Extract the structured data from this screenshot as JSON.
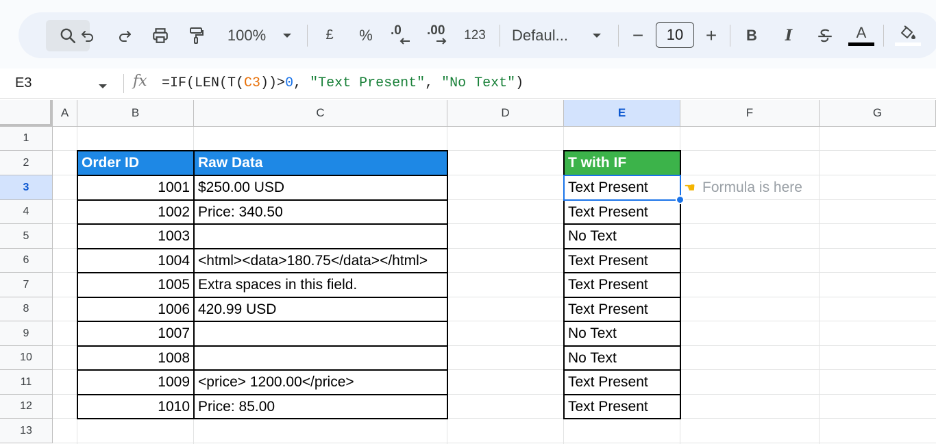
{
  "toolbar": {
    "zoom": "100%",
    "currency": "£",
    "percent": "%",
    "decrease_decimal": ".0",
    "increase_decimal": ".00",
    "number_format": "123",
    "font": "Defaul...",
    "font_size": "10",
    "minus": "−",
    "plus": "+",
    "bold": "B",
    "italic": "I",
    "text_color_letter": "A"
  },
  "formula_bar": {
    "name_box": "E3",
    "fx": "fx",
    "formula_parts": {
      "p1": "=IF(LEN(T(",
      "ref": "C3",
      "p2": "))>",
      "num": "0",
      "p3": ", ",
      "str1": "\"Text Present\"",
      "p4": ", ",
      "str2": "\"No Text\"",
      "p5": ")"
    }
  },
  "columns": [
    "A",
    "B",
    "C",
    "D",
    "E",
    "F",
    "G"
  ],
  "active_column": "E",
  "rows": [
    "1",
    "2",
    "3",
    "4",
    "5",
    "6",
    "7",
    "8",
    "9",
    "10",
    "11",
    "12",
    "13"
  ],
  "active_row": "3",
  "table1": {
    "headers": [
      "Order ID",
      "Raw Data"
    ],
    "rows": [
      [
        "1001",
        "$250.00 USD"
      ],
      [
        "1002",
        "Price: 340.50"
      ],
      [
        "1003",
        ""
      ],
      [
        "1004",
        "<html><data>180.75</data></html>"
      ],
      [
        "1005",
        "Extra spaces in this field."
      ],
      [
        "1006",
        "420.99 USD"
      ],
      [
        "1007",
        ""
      ],
      [
        "1008",
        ""
      ],
      [
        "1009",
        "<price> 1200.00</price>"
      ],
      [
        "1010",
        "Price: 85.00"
      ]
    ],
    "header_color": "#1e88e5"
  },
  "table2": {
    "header": "T with IF",
    "values": [
      "Text Present",
      "Text Present",
      "No Text",
      "Text Present",
      "Text Present",
      "Text Present",
      "No Text",
      "No Text",
      "Text Present",
      "Text Present"
    ],
    "header_color": "#3cb34a"
  },
  "note": {
    "icon": "pointing-hand-icon",
    "text": "Formula is here"
  },
  "colors": {
    "selection": "#1a73e8",
    "active_header_bg": "#d3e3fd"
  }
}
